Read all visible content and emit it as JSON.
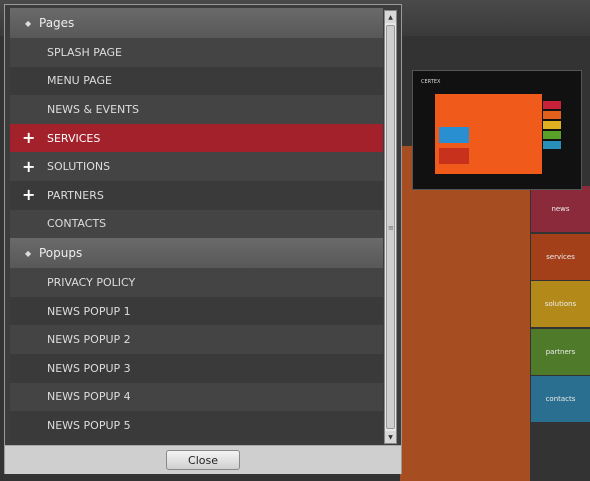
{
  "dialog": {
    "sections": [
      {
        "title": "Pages",
        "items": [
          {
            "label": "SPLASH PAGE",
            "expandable": false,
            "selected": false
          },
          {
            "label": "MENU PAGE",
            "expandable": false,
            "selected": false
          },
          {
            "label": "NEWS & EVENTS",
            "expandable": false,
            "selected": false
          },
          {
            "label": "SERVICES",
            "expandable": true,
            "selected": true
          },
          {
            "label": "SOLUTIONS",
            "expandable": true,
            "selected": false
          },
          {
            "label": "PARTNERS",
            "expandable": true,
            "selected": false
          },
          {
            "label": "CONTACTS",
            "expandable": false,
            "selected": false
          }
        ]
      },
      {
        "title": "Popups",
        "items": [
          {
            "label": "PRIVACY POLICY",
            "expandable": false,
            "selected": false
          },
          {
            "label": "NEWS POPUP 1",
            "expandable": false,
            "selected": false
          },
          {
            "label": "NEWS POPUP 2",
            "expandable": false,
            "selected": false
          },
          {
            "label": "NEWS POPUP 3",
            "expandable": false,
            "selected": false
          },
          {
            "label": "NEWS POPUP 4",
            "expandable": false,
            "selected": false
          },
          {
            "label": "NEWS POPUP 5",
            "expandable": false,
            "selected": false
          }
        ]
      }
    ],
    "close_label": "Close",
    "colors": {
      "selected": "#a3212a",
      "header": "#606060"
    },
    "icons": {
      "bullet": "diamond-bullet-icon",
      "expand": "plus-icon"
    }
  },
  "background": {
    "tiles": [
      {
        "label": "news",
        "color": "#8b2a3a"
      },
      {
        "label": "services",
        "color": "#a3401a"
      },
      {
        "label": "solutions",
        "color": "#b38a1a"
      },
      {
        "label": "partners",
        "color": "#4f7a2a"
      },
      {
        "label": "contacts",
        "color": "#2a6f8f"
      }
    ],
    "preview_logo": "CERTEX"
  }
}
